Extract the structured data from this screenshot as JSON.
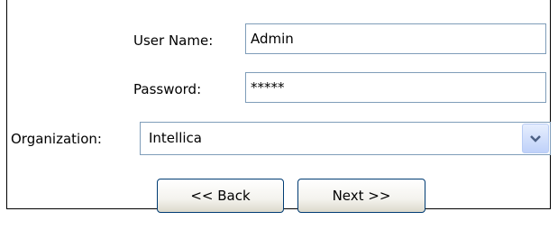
{
  "form": {
    "username_label": "User Name:",
    "username_value": "Admin",
    "password_label": "Password:",
    "password_value": "*****",
    "organization_label": "Organization:",
    "organization_selected": "Intellica"
  },
  "buttons": {
    "back_label": "<< Back",
    "next_label": "Next >>"
  },
  "icons": {
    "dropdown": "chevron-down-icon"
  },
  "colors": {
    "field_border": "#7f9db9",
    "button_border": "#003c74",
    "dropdown_arrow": "#4d6185"
  }
}
